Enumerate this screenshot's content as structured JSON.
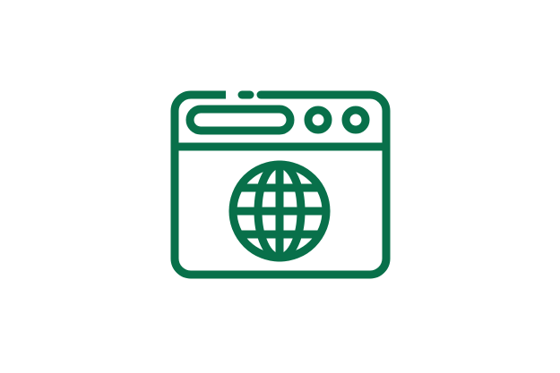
{
  "icon": {
    "name": "browser-globe-icon",
    "color": "#08704A",
    "background": "#ffffff"
  }
}
